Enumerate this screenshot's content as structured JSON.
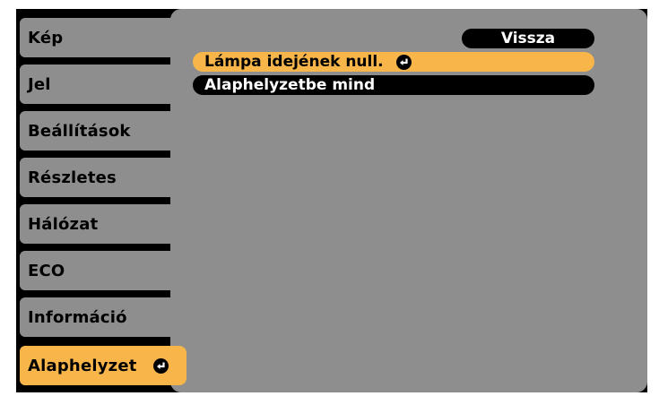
{
  "sidebar": {
    "items": [
      {
        "label": "Kép"
      },
      {
        "label": "Jel"
      },
      {
        "label": "Beállítások"
      },
      {
        "label": "Részletes"
      },
      {
        "label": "Hálózat"
      },
      {
        "label": "ECO"
      },
      {
        "label": "Információ"
      },
      {
        "label": "Alaphelyzet",
        "active": true,
        "icon": "enter-icon"
      }
    ]
  },
  "panel": {
    "back_label": "Vissza",
    "rows": [
      {
        "label": "Lámpa idejének null.",
        "selected": true,
        "icon": "enter-icon"
      },
      {
        "label": "Alaphelyzetbe mind",
        "selected": false
      }
    ]
  },
  "colors": {
    "accent": "#f7b54a",
    "tab_gray": "#8e8e8e",
    "background": "#000000"
  }
}
